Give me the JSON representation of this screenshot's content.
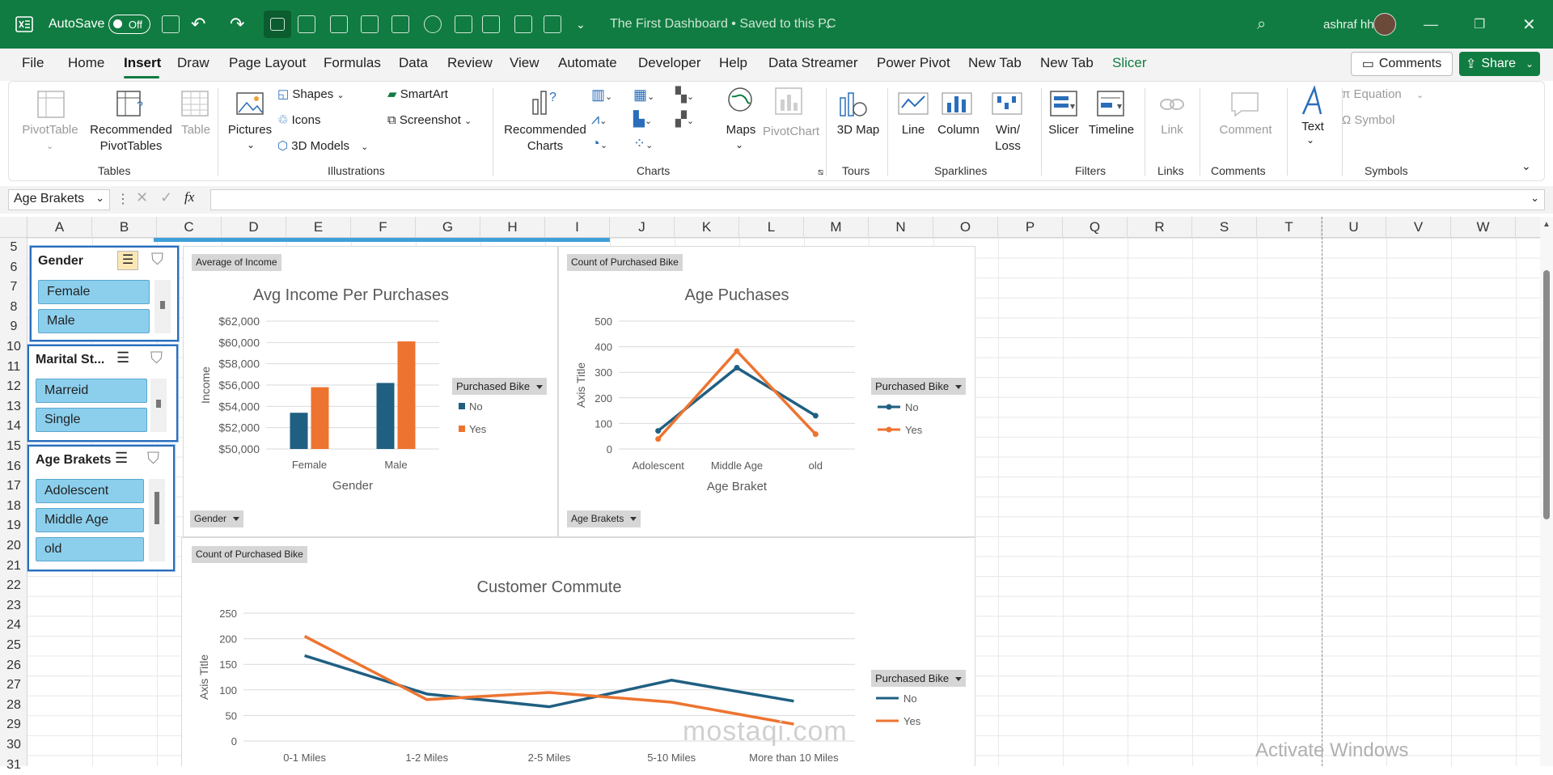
{
  "titlebar": {
    "autosave_label": "AutoSave",
    "autosave_state": "Off",
    "document_title": "The First Dashboard • Saved to this PC",
    "user_name": "ashraf hh"
  },
  "menu": {
    "tabs": [
      "File",
      "Home",
      "Insert",
      "Draw",
      "Page Layout",
      "Formulas",
      "Data",
      "Review",
      "View",
      "Automate",
      "Developer",
      "Help",
      "Data Streamer",
      "Power Pivot",
      "New Tab",
      "New Tab",
      "Slicer"
    ],
    "active_tab": "Insert",
    "comments_label": "Comments",
    "share_label": "Share"
  },
  "ribbon": {
    "pivottable": "PivotTable",
    "recommended_pivottables": "Recommended PivotTables",
    "table": "Table",
    "pictures": "Pictures",
    "shapes": "Shapes",
    "icons": "Icons",
    "models3d": "3D Models",
    "smartart": "SmartArt",
    "screenshot": "Screenshot",
    "recommended_charts": "Recommended Charts",
    "maps": "Maps",
    "pivotchart": "PivotChart",
    "map3d": "3D Map",
    "line": "Line",
    "column": "Column",
    "winloss": "Win/ Loss",
    "slicer": "Slicer",
    "timeline": "Timeline",
    "link": "Link",
    "comment": "Comment",
    "text": "Text",
    "equation": "Equation",
    "symbol": "Symbol",
    "groups": {
      "tables": "Tables",
      "illustrations": "Illustrations",
      "charts": "Charts",
      "tours": "Tours",
      "sparklines": "Sparklines",
      "filters": "Filters",
      "links": "Links",
      "comments": "Comments",
      "symbols": "Symbols"
    }
  },
  "formula_bar": {
    "name_box": "Age Brakets",
    "formula": ""
  },
  "columns": [
    "A",
    "B",
    "C",
    "D",
    "E",
    "F",
    "G",
    "H",
    "I",
    "J",
    "K",
    "L",
    "M",
    "N",
    "O",
    "P",
    "Q",
    "R",
    "S",
    "T",
    "U",
    "V",
    "W"
  ],
  "rows": [
    "5",
    "6",
    "7",
    "8",
    "9",
    "10",
    "11",
    "12",
    "13",
    "14",
    "15",
    "16",
    "17",
    "18",
    "19",
    "20",
    "21",
    "22",
    "23",
    "24",
    "25",
    "26",
    "27",
    "28",
    "29",
    "30",
    "31"
  ],
  "slicers": [
    {
      "title": "Gender",
      "items": [
        "Female",
        "Male"
      ]
    },
    {
      "title": "Marital St...",
      "items": [
        "Marreid",
        "Single"
      ]
    },
    {
      "title": "Age Brakets",
      "items": [
        "Adolescent",
        "Middle Age",
        "old"
      ]
    }
  ],
  "field_buttons": {
    "chart1_value": "Average of Income",
    "chart1_axis": "Gender",
    "chart1_legend": "Purchased Bike",
    "chart2_value": "Count of Purchased Bike",
    "chart2_axis": "Age Brakets",
    "chart2_legend": "Purchased Bike",
    "chart3_value": "Count of Purchased Bike",
    "chart3_legend": "Purchased Bike"
  },
  "colors": {
    "excel_green": "#107c41",
    "series_no": "#1f5f82",
    "series_yes": "#ed7430",
    "slicer_item": "#8ccfed"
  },
  "chart_data": [
    {
      "type": "bar",
      "title": "Avg Income Per Purchases",
      "xlabel": "Gender",
      "ylabel": "Income",
      "categories": [
        "Female",
        "Male"
      ],
      "series": [
        {
          "name": "No",
          "values": [
            53400,
            56200
          ]
        },
        {
          "name": "Yes",
          "values": [
            55800,
            60100
          ]
        }
      ],
      "ylim": [
        50000,
        62000
      ],
      "yticks": [
        "$50,000",
        "$52,000",
        "$54,000",
        "$56,000",
        "$58,000",
        "$60,000",
        "$62,000"
      ],
      "legend": "right"
    },
    {
      "type": "line",
      "title": "Age Puchases",
      "xlabel": "Age Braket",
      "ylabel": "Axis Title",
      "categories": [
        "Adolescent",
        "Middle Age",
        "old"
      ],
      "series": [
        {
          "name": "No",
          "values": [
            71,
            318,
            130
          ]
        },
        {
          "name": "Yes",
          "values": [
            39,
            383,
            58
          ]
        }
      ],
      "ylim": [
        0,
        500
      ],
      "yticks": [
        "0",
        "100",
        "200",
        "300",
        "400",
        "500"
      ],
      "legend": "right"
    },
    {
      "type": "line",
      "title": "Customer Commute",
      "xlabel": "",
      "ylabel": "Axis Title",
      "categories": [
        "0-1 Miles",
        "1-2 Miles",
        "2-5 Miles",
        "5-10 Miles",
        "More than 10 Miles"
      ],
      "series": [
        {
          "name": "No",
          "values": [
            167,
            92,
            67,
            119,
            78
          ]
        },
        {
          "name": "Yes",
          "values": [
            205,
            81,
            95,
            76,
            33
          ]
        }
      ],
      "ylim": [
        0,
        250
      ],
      "yticks": [
        "0",
        "50",
        "100",
        "150",
        "200",
        "250"
      ],
      "legend": "right"
    }
  ],
  "watermark": "Activate Windows",
  "overlay_watermark": "mostaqi.com"
}
